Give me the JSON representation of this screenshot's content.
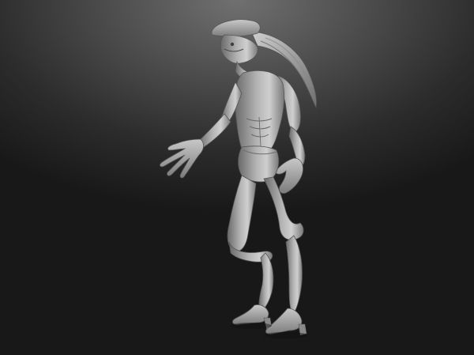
{
  "scene": {
    "background_top": "#707070",
    "background_bottom": "#181818",
    "material_color": "#a8a8a8",
    "material_highlight": "#d2d2d2",
    "material_shadow": "#5e5e5e"
  }
}
